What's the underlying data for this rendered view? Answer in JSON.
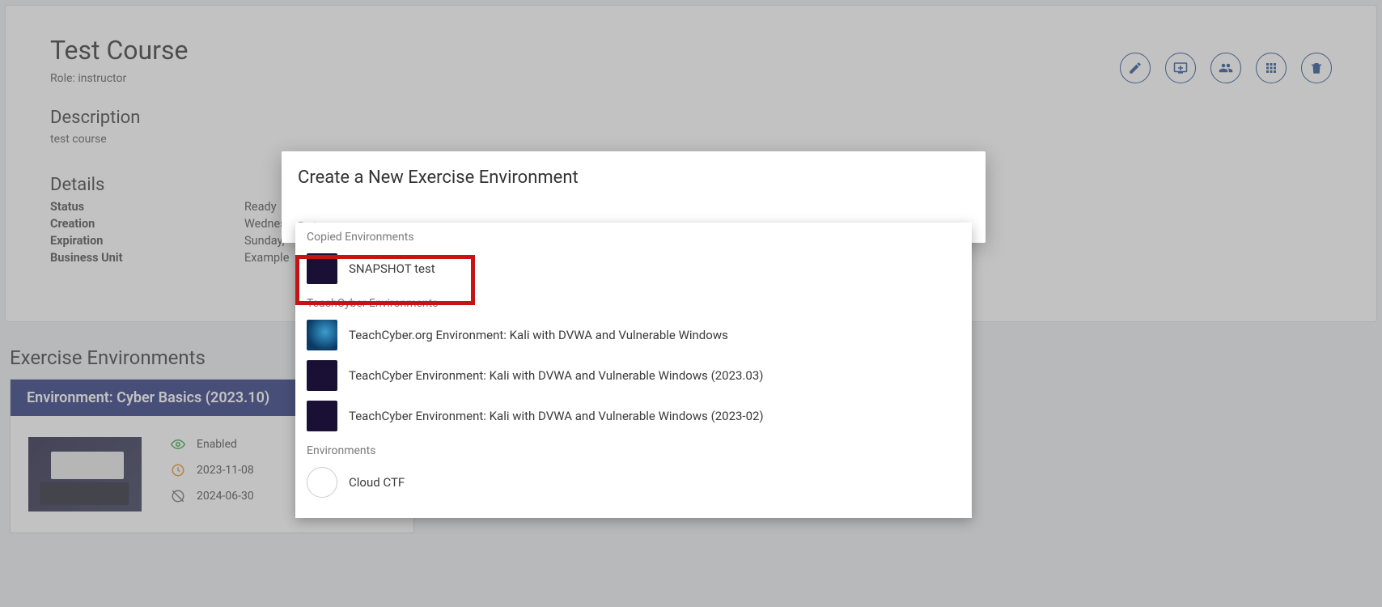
{
  "course": {
    "title": "Test Course",
    "role_prefix": "Role: ",
    "role": "instructor",
    "description_heading": "Description",
    "description": "test course",
    "details_heading": "Details",
    "details": {
      "status_label": "Status",
      "status_value": "Ready",
      "creation_label": "Creation",
      "creation_value": "Wednes",
      "expiration_label": "Expiration",
      "expiration_value": "Sunday,",
      "business_unit_label": "Business Unit",
      "business_unit_value": "Example"
    }
  },
  "toolbar": {
    "edit": "edit",
    "add_env": "add-environment",
    "users": "users",
    "grid": "grid",
    "delete": "delete"
  },
  "exercise_section": {
    "heading": "Exercise Environments",
    "env_card": {
      "header": "Environment: Cyber Basics (2023.10)",
      "status": "Enabled",
      "created": "2023-11-08",
      "expires": "2024-06-30"
    }
  },
  "modal": {
    "title": "Create a New Exercise Environment",
    "field_label": "Environment",
    "groups": [
      {
        "label": "Copied Environments",
        "items": [
          {
            "name": "SNAPSHOT test",
            "thumb": "dark",
            "highlight": true
          }
        ]
      },
      {
        "label": "TeachCyber Environments",
        "items": [
          {
            "name": "TeachCyber.org Environment: Kali with DVWA and Vulnerable Windows",
            "thumb": "kali"
          },
          {
            "name": "TeachCyber Environment: Kali with DVWA and Vulnerable Windows (2023.03)",
            "thumb": "dark"
          },
          {
            "name": "TeachCyber Environment: Kali with DVWA and Vulnerable Windows (2023-02)",
            "thumb": "dark"
          }
        ]
      },
      {
        "label": "Environments",
        "items": [
          {
            "name": "Cloud CTF",
            "thumb": "ctf"
          }
        ]
      }
    ]
  }
}
